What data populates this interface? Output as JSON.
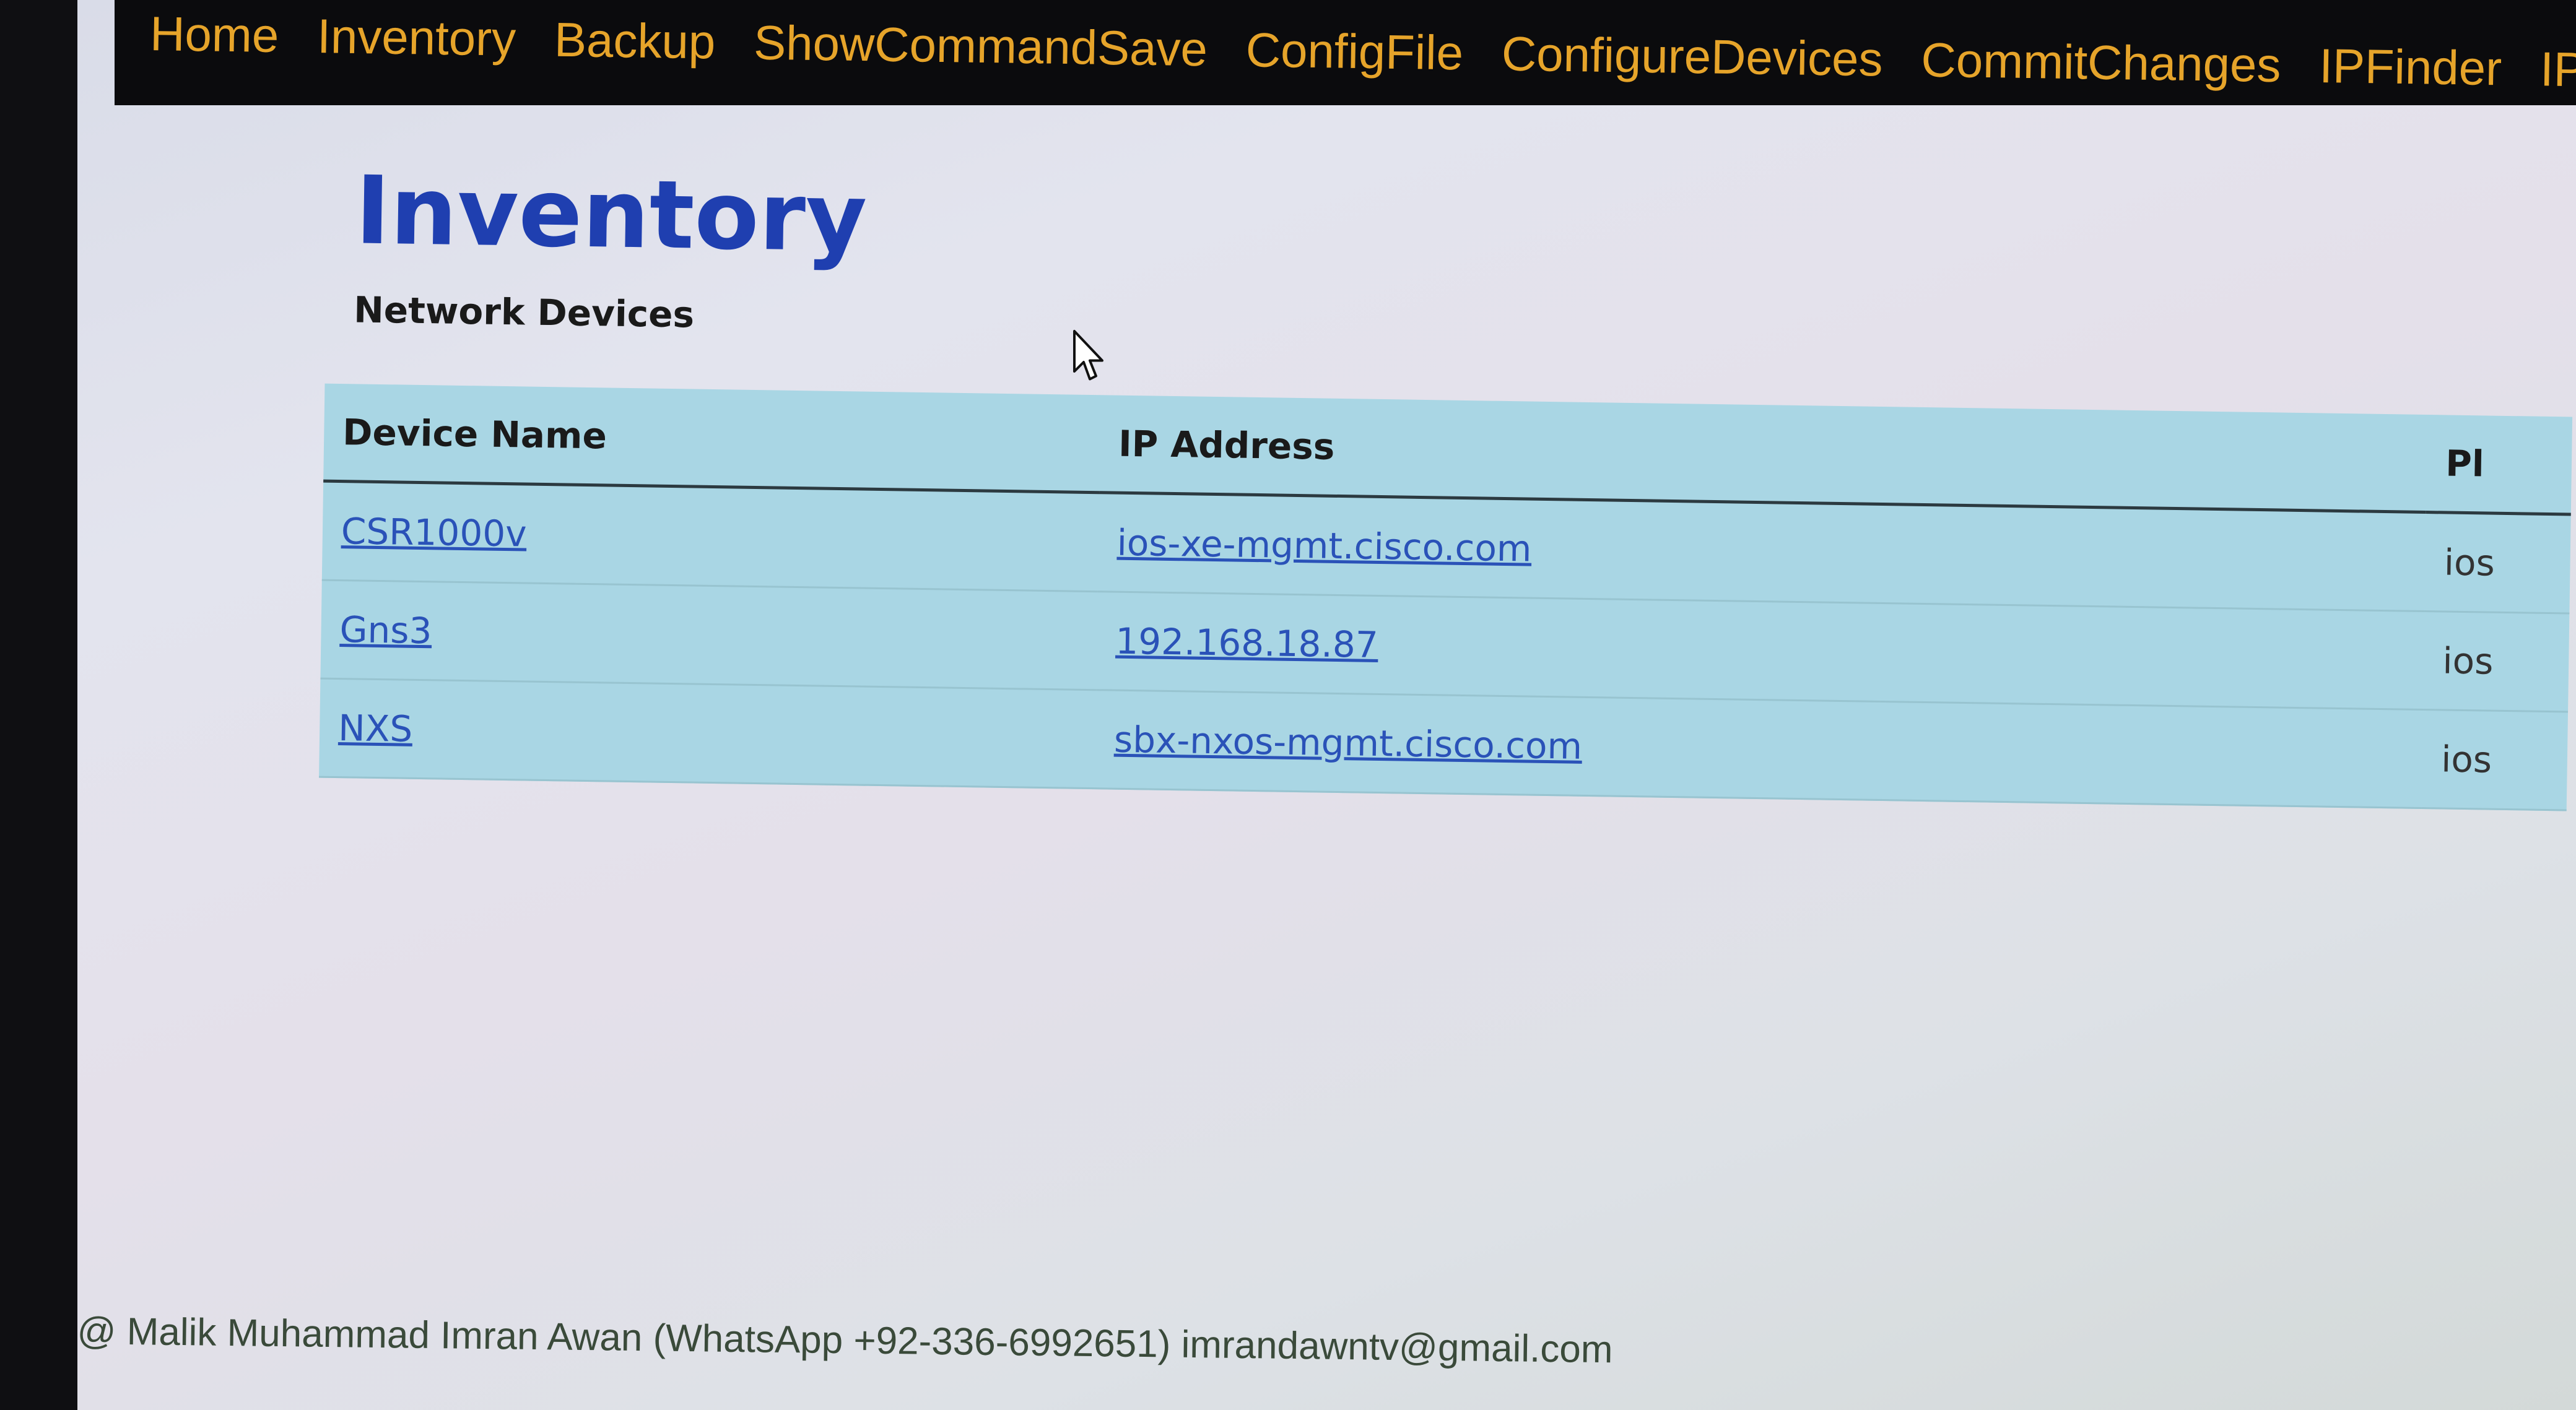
{
  "nav": {
    "items": [
      {
        "label": "Home"
      },
      {
        "label": "Inventory"
      },
      {
        "label": "Backup"
      },
      {
        "label": "ShowCommandSave"
      },
      {
        "label": "ConfigFile"
      },
      {
        "label": "ConfigureDevices"
      },
      {
        "label": "CommitChanges"
      },
      {
        "label": "IPFinder"
      },
      {
        "label": "IPAdd"
      }
    ]
  },
  "page": {
    "title": "Inventory",
    "subtitle": "Network Devices"
  },
  "table": {
    "headers": [
      "Device Name",
      "IP Address",
      "Pl"
    ],
    "rows": [
      {
        "name": "CSR1000v",
        "ip": "ios-xe-mgmt.cisco.com",
        "platform": "ios"
      },
      {
        "name": "Gns3",
        "ip": "192.168.18.87",
        "platform": "ios"
      },
      {
        "name": "NXS",
        "ip": "sbx-nxos-mgmt.cisco.com",
        "platform": "ios"
      }
    ]
  },
  "footer": {
    "text": "@ Malik Muhammad Imran Awan (WhatsApp +92-336-6992651) imrandawntv@gmail.com"
  },
  "colors": {
    "nav_bg": "#0b0b0d",
    "nav_text": "#e6a42a",
    "title": "#1f3fb0",
    "table_bg": "#a9d6e4",
    "link": "#2a52b8"
  }
}
